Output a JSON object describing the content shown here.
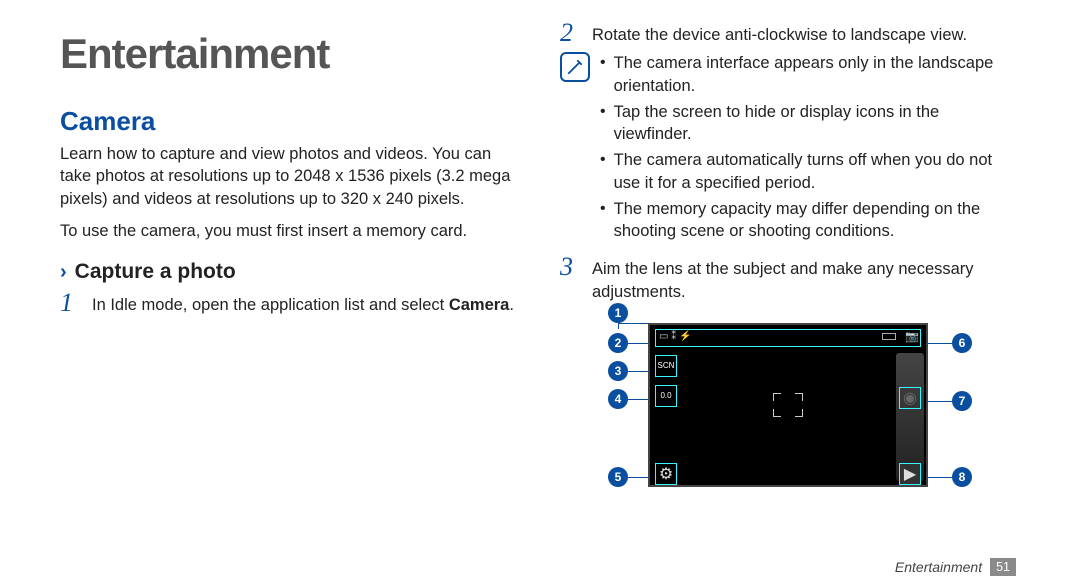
{
  "page_title": "Entertainment",
  "section_title": "Camera",
  "intro_p1": "Learn how to capture and view photos and videos. You can take photos at resolutions up to 2048 x 1536 pixels (3.2 mega pixels) and videos at resolutions up to 320 x 240 pixels.",
  "intro_p2": "To use the camera, you must first insert a memory card.",
  "subhead_chevron": "›",
  "subhead": "Capture a photo",
  "step1_num": "1",
  "step1_text": "In Idle mode, open the application list and select ",
  "step1_bold": "Camera",
  "step1_suffix": ".",
  "step2_num": "2",
  "step2_text": "Rotate the device anti-clockwise to landscape view.",
  "notes": {
    "n1": "The camera interface appears only in the landscape orientation.",
    "n2": "Tap the screen to hide or display icons in the viewfinder.",
    "n3": "The camera automatically turns off when you do not use it for a specified period.",
    "n4": "The memory capacity may differ depending on the shooting scene or shooting conditions."
  },
  "step3_num": "3",
  "step3_text": "Aim the lens at the subject and make any necessary adjustments.",
  "callouts": {
    "c1": "1",
    "c2": "2",
    "c3": "3",
    "c4": "4",
    "c5": "5",
    "c6": "6",
    "c7": "7",
    "c8": "8"
  },
  "diagram_labels": {
    "scn": "SCN",
    "ev": "0.0"
  },
  "footer_section": "Entertainment",
  "footer_page": "51"
}
